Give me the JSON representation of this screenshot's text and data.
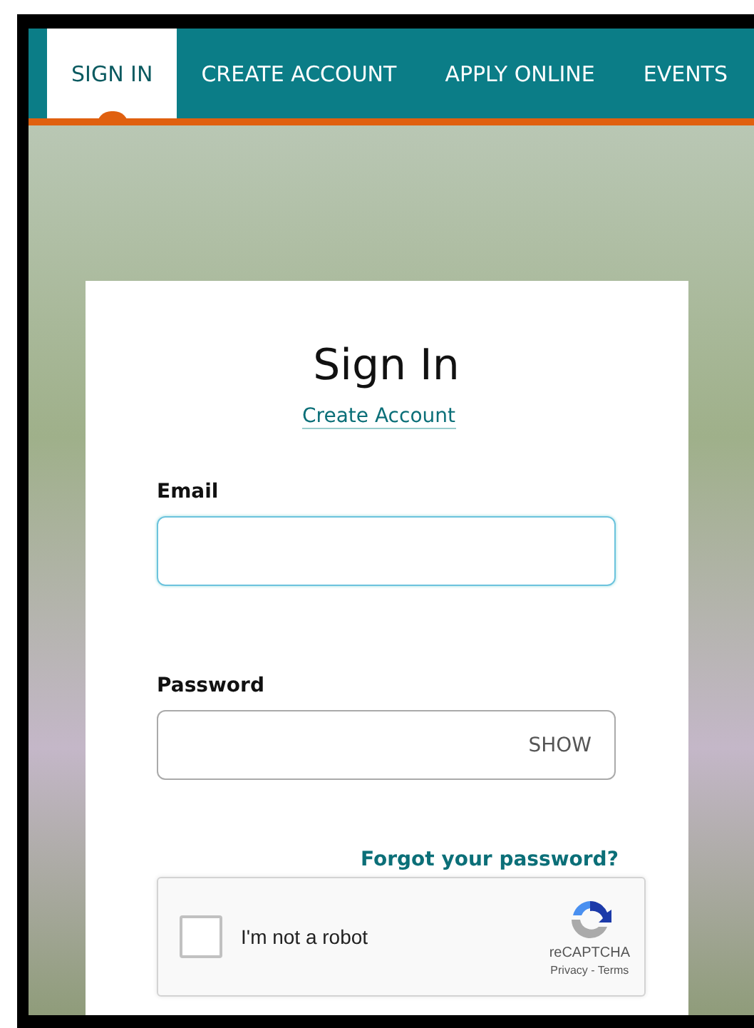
{
  "nav": {
    "tabs": [
      {
        "label": "SIGN IN",
        "selected": true
      },
      {
        "label": "CREATE ACCOUNT",
        "selected": false
      },
      {
        "label": "APPLY ONLINE",
        "selected": false
      },
      {
        "label": "EVENTS",
        "selected": false
      }
    ]
  },
  "form": {
    "title": "Sign In",
    "create_account_link": "Create Account",
    "fields": [
      {
        "label": "Email",
        "focused": true
      },
      {
        "label": "Password",
        "focused": false,
        "toggle": "SHOW"
      }
    ],
    "forgot_link": "Forgot your password?",
    "captcha": {
      "label": "I'm not a robot",
      "checked": false,
      "brand": "reCAPTCHA",
      "links": "Privacy - Terms"
    }
  }
}
